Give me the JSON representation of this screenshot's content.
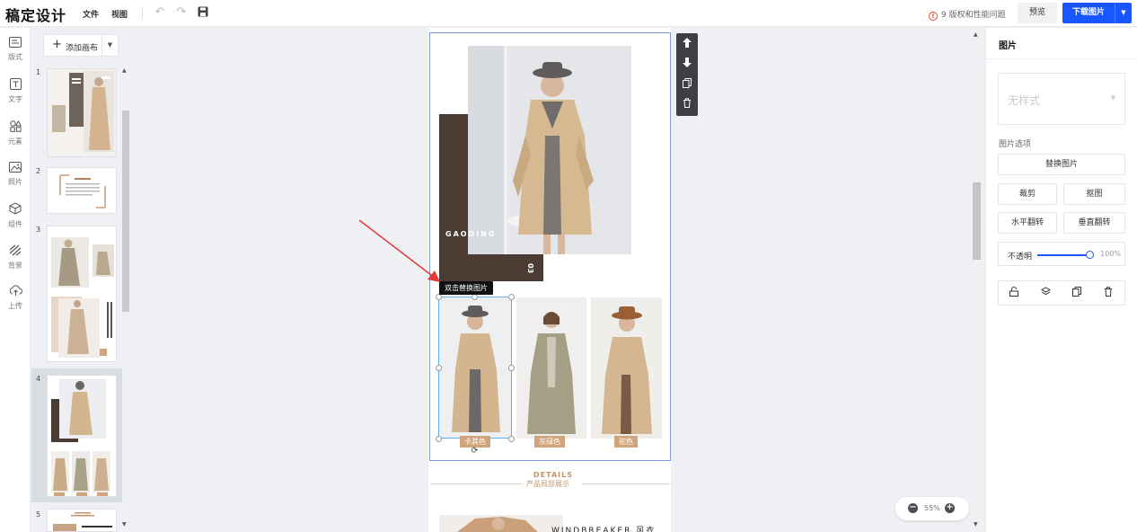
{
  "app": {
    "logo": "稿定设计",
    "menu": [
      "文件",
      "视图"
    ],
    "warning": "9 版权和性能问题",
    "preview_label": "预览",
    "download_label": "下载图片"
  },
  "leftnav": [
    {
      "icon": "layout-icon",
      "label": "版式"
    },
    {
      "icon": "text-icon",
      "label": "文字"
    },
    {
      "icon": "elements-icon",
      "label": "元素"
    },
    {
      "icon": "photo-icon",
      "label": "照片"
    },
    {
      "icon": "component-icon",
      "label": "组件"
    },
    {
      "icon": "background-icon",
      "label": "背景"
    },
    {
      "icon": "upload-icon",
      "label": "上传"
    }
  ],
  "pages": {
    "add_label": "添加画布",
    "numbers": [
      "1",
      "2",
      "3",
      "4",
      "5"
    ]
  },
  "canvas": {
    "brand": "GAODING",
    "brand_num": "03",
    "tooltip": "双击替换图片",
    "tags": [
      "卡其色",
      "灰绿色",
      "驼色"
    ],
    "details_en": "DETAILS",
    "details_cn": "产品局部展示",
    "windbreaker": "WINDBREAKER 风衣",
    "zoom": "55%"
  },
  "panel": {
    "title": "图片",
    "style_placeholder": "无样式",
    "options_label": "图片选项",
    "replace": "替换图片",
    "crop": "裁剪",
    "cutout": "抠图",
    "flip_h": "水平翻转",
    "flip_v": "垂直翻转",
    "opacity_label": "不透明",
    "opacity_value": "100%"
  }
}
